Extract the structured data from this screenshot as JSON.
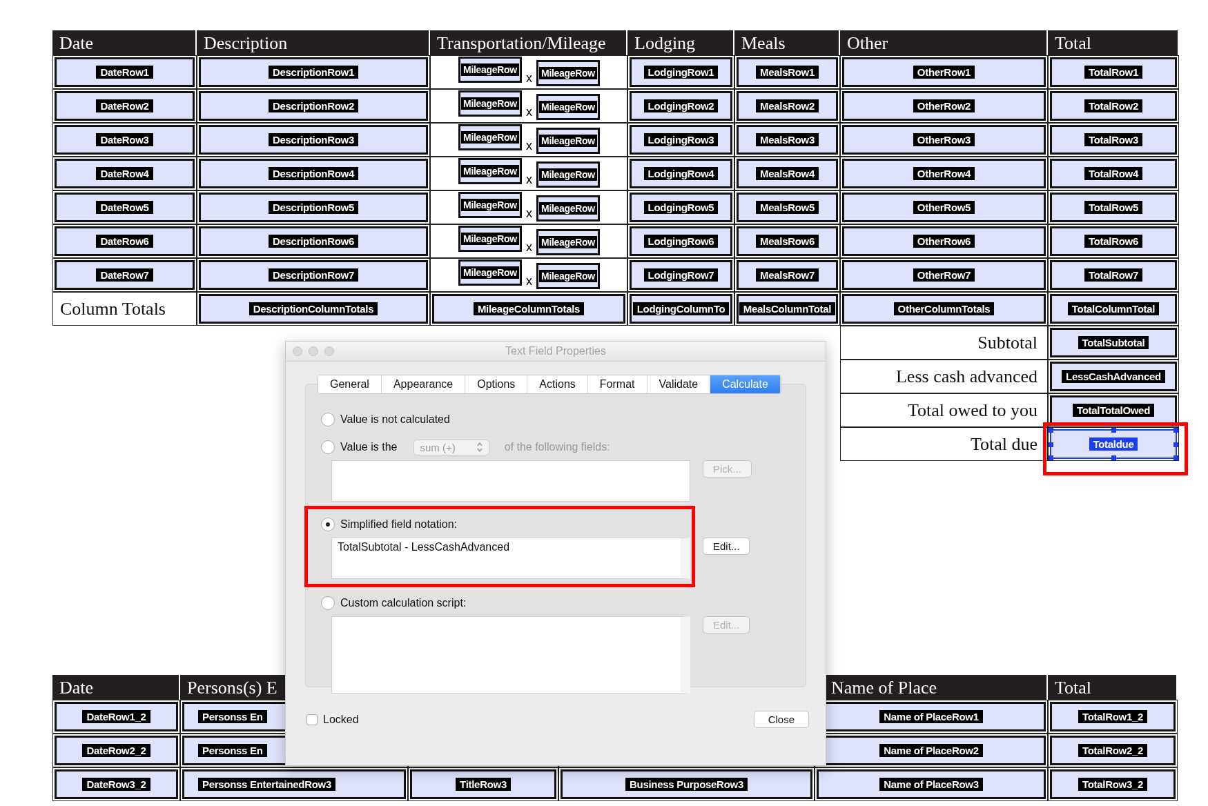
{
  "expense_table": {
    "columns": [
      "Date",
      "Description",
      "Transportation/Mileage",
      "Lodging",
      "Meals",
      "Other",
      "Total"
    ],
    "rows": [
      {
        "date": "DateRow1",
        "description": "DescriptionRow1",
        "mileage": [
          "MileageRow",
          "MileageRow"
        ],
        "times": "x",
        "lodging": "LodgingRow1",
        "meals": "MealsRow1",
        "other": "OtherRow1",
        "total": "TotalRow1"
      },
      {
        "date": "DateRow2",
        "description": "DescriptionRow2",
        "mileage": [
          "MileageRow",
          "MileageRow"
        ],
        "times": "x",
        "lodging": "LodgingRow2",
        "meals": "MealsRow2",
        "other": "OtherRow2",
        "total": "TotalRow2"
      },
      {
        "date": "DateRow3",
        "description": "DescriptionRow3",
        "mileage": [
          "MileageRow",
          "MileageRow"
        ],
        "times": "x",
        "lodging": "LodgingRow3",
        "meals": "MealsRow3",
        "other": "OtherRow3",
        "total": "TotalRow3"
      },
      {
        "date": "DateRow4",
        "description": "DescriptionRow4",
        "mileage": [
          "MileageRow",
          "MileageRow"
        ],
        "times": "x",
        "lodging": "LodgingRow4",
        "meals": "MealsRow4",
        "other": "OtherRow4",
        "total": "TotalRow4"
      },
      {
        "date": "DateRow5",
        "description": "DescriptionRow5",
        "mileage": [
          "MileageRow",
          "MileageRow"
        ],
        "times": "x",
        "lodging": "LodgingRow5",
        "meals": "MealsRow5",
        "other": "OtherRow5",
        "total": "TotalRow5"
      },
      {
        "date": "DateRow6",
        "description": "DescriptionRow6",
        "mileage": [
          "MileageRow",
          "MileageRow"
        ],
        "times": "x",
        "lodging": "LodgingRow6",
        "meals": "MealsRow6",
        "other": "OtherRow6",
        "total": "TotalRow6"
      },
      {
        "date": "DateRow7",
        "description": "DescriptionRow7",
        "mileage": [
          "MileageRow",
          "MileageRow"
        ],
        "times": "x",
        "lodging": "LodgingRow7",
        "meals": "MealsRow7",
        "other": "OtherRow7",
        "total": "TotalRow7"
      }
    ],
    "totals_row": {
      "label": "Column Totals",
      "fields": [
        "DescriptionColumnTotals",
        "MileageColumnTotals",
        "LodgingColumnTo",
        "MealsColumnTotal",
        "OtherColumnTotals",
        "TotalColumnTotal"
      ]
    }
  },
  "summary": [
    {
      "label": "Subtotal",
      "field": "TotalSubtotal",
      "selected": false,
      "highlighted": false
    },
    {
      "label": "Less cash advanced",
      "field": "LessCashAdvanced",
      "selected": false,
      "highlighted": false
    },
    {
      "label": "Total owed to you",
      "field": "TotalTotalOwed",
      "selected": false,
      "highlighted": false
    },
    {
      "label": "Total due",
      "field": "Totaldue",
      "selected": true,
      "highlighted": true
    }
  ],
  "dialog": {
    "title": "Text Field Properties",
    "tabs": [
      {
        "label": "General",
        "selected": false
      },
      {
        "label": "Appearance",
        "selected": false
      },
      {
        "label": "Options",
        "selected": false
      },
      {
        "label": "Actions",
        "selected": false
      },
      {
        "label": "Format",
        "selected": false
      },
      {
        "label": "Validate",
        "selected": false
      },
      {
        "label": "Calculate",
        "selected": true
      }
    ],
    "options": [
      {
        "kind": "none",
        "label": "Value is not calculated",
        "selected": false,
        "highlighted": false
      },
      {
        "kind": "function",
        "label": "Value is the",
        "function": "sum (+)",
        "suffix": "of the following fields:",
        "button": "Pick...",
        "selected": false,
        "highlighted": false
      },
      {
        "kind": "notation",
        "label": "Simplified field notation:",
        "value": "TotalSubtotal - LessCashAdvanced",
        "button": "Edit...",
        "selected": true,
        "highlighted": true
      },
      {
        "kind": "script",
        "label": "Custom calculation script:",
        "button": "Edit...",
        "selected": false,
        "highlighted": false
      }
    ],
    "locked": {
      "label": "Locked",
      "checked": false
    },
    "close_button": "Close"
  },
  "entertainment_table": {
    "columns": [
      "Date",
      "Persons(s) E",
      null,
      null,
      "Name of Place",
      "Total"
    ],
    "rows": [
      [
        "DateRow1_2",
        "Personss En",
        null,
        null,
        "Name of PlaceRow1",
        "TotalRow1_2"
      ],
      [
        "DateRow2_2",
        "Personss En",
        null,
        null,
        "Name of PlaceRow2",
        "TotalRow2_2"
      ],
      [
        "DateRow3_2",
        "Personss EntertainedRow3",
        "TitleRow3",
        "Business PurposeRow3",
        "Name of PlaceRow3",
        "TotalRow3_2"
      ]
    ]
  }
}
